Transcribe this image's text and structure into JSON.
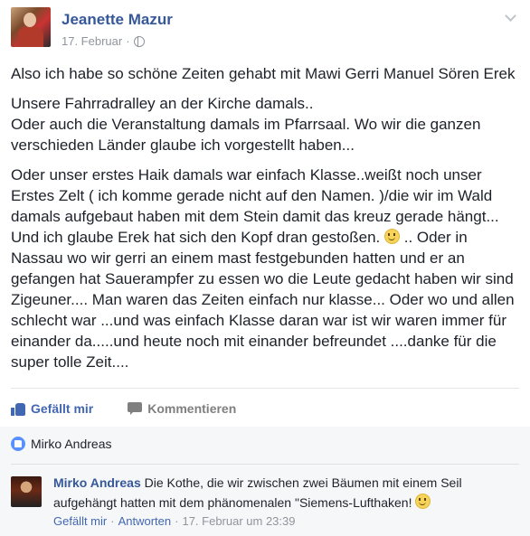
{
  "post": {
    "author": "Jeanette Mazur",
    "date": "17. Februar",
    "separator": "·",
    "paragraphs": [
      "Also ich habe so schöne Zeiten gehabt mit Mawi Gerri Manuel Sören Erek",
      "Unsere Fahrradralley an der Kirche damals.. Oder auch die Veranstaltung damals im Pfarrsaal. Wo wir die ganzen verschieden Länder glaube ich vorgestellt haben...",
      "Oder unser erstes Haik damals war einfach Klasse..weißt noch unser Erstes Zelt ( ich komme gerade nicht auf den Namen. )/die wir im Wald damals aufgebaut haben mit dem Stein damit das kreuz gerade hängt... Und ich glaube Erek hat sich den Kopf dran gestoßen.",
      ".. Oder in Nassau wo wir gerri an einem mast festgebunden hatten und er an gefangen hat Sauerampfer zu essen wo die Leute gedacht haben wir sind Zigeuner.... Man waren das Zeiten einfach nur klasse... Oder wo und allen schlecht war ...und was einfach Klasse daran war ist wir waren immer für einander da.....und heute noch mit einander befreundet ....danke für die super tolle Zeit...."
    ],
    "line_2a": "Unsere Fahrradralley an der Kirche damals..",
    "line_2b": "Oder auch die Veranstaltung damals im Pfarrsaal. Wo wir die ganzen verschieden Länder glaube ich vorgestellt haben..."
  },
  "actions": {
    "like_label": "Gefällt mir",
    "comment_label": "Kommentieren"
  },
  "likes": {
    "names": "Mirko Andreas"
  },
  "comment": {
    "author": "Mirko Andreas",
    "text": "Die Kothe, die wir zwischen zwei Bäumen mit einem Seil aufgehängt hatten mit dem phänomenalen \"Siemens-Lufthaken!",
    "like_label": "Gefällt mir",
    "reply_label": "Antworten",
    "timestamp": "17. Februar um 23:39",
    "separator": "·"
  },
  "icons": {
    "privacy": "globe-icon",
    "menu": "chevron-down-icon",
    "like": "thumbs-up-icon",
    "comment": "comment-icon",
    "emoji": "smiley-icon"
  },
  "colors": {
    "link": "#365899",
    "action_blue": "#4267b2",
    "meta_gray": "#90949c"
  }
}
